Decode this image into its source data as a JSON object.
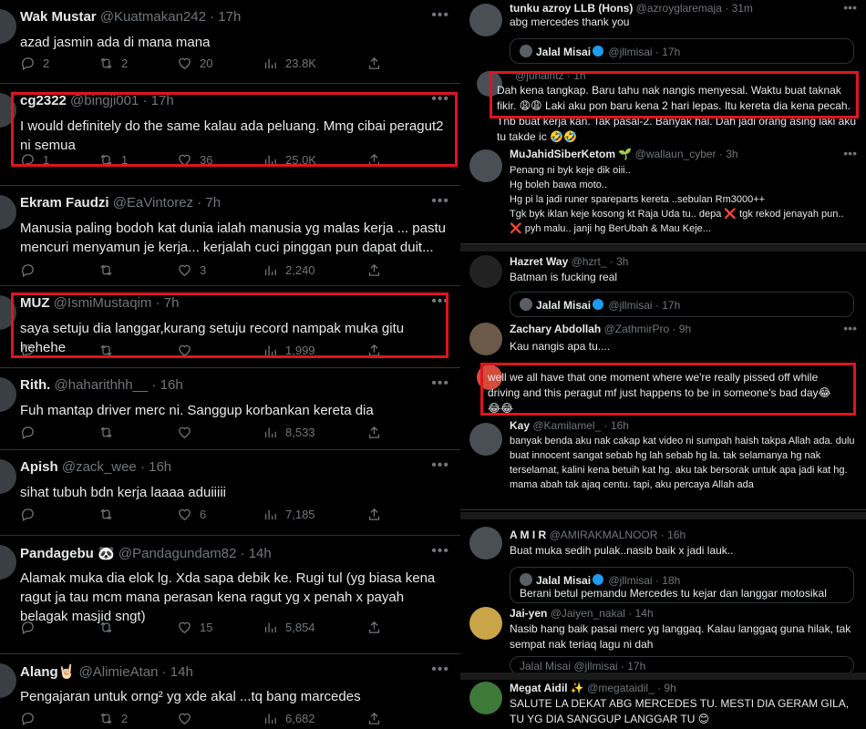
{
  "left": {
    "tweets": [
      {
        "name": "Wak Mustar",
        "handle": "@Kuatmakan242",
        "time": "· 17h",
        "text": "azad jasmin ada di mana mana",
        "replies": "2",
        "retweets": "2",
        "likes": "20",
        "views": "23.8K"
      },
      {
        "name": "cg2322",
        "handle": "@bingji001",
        "time": "· 17h",
        "text": "I would definitely do the same kalau ada peluang. Mmg cibai peragut2 ni semua",
        "replies": "1",
        "retweets": "1",
        "likes": "36",
        "views": "25.0K"
      },
      {
        "name": "Ekram Faudzi",
        "handle": "@EaVintorez",
        "time": "· 7h",
        "text": "Manusia paling bodoh kat dunia ialah manusia yg malas kerja ... pastu mencuri menyamun je kerja... kerjalah cuci pinggan pun dapat duit...",
        "replies": "",
        "retweets": "",
        "likes": "3",
        "views": "2,240"
      },
      {
        "name": "MUZ",
        "handle": "@IsmiMustaqim",
        "time": "· 7h",
        "text": "saya setuju dia langgar,kurang setuju record nampak muka gitu hehehe",
        "replies": "",
        "retweets": "",
        "likes": "",
        "views": "1,999"
      },
      {
        "name": "Rith.",
        "handle": "@haharithhh__",
        "time": "· 16h",
        "text": "Fuh mantap driver merc ni. Sanggup korbankan kereta dia",
        "replies": "",
        "retweets": "",
        "likes": "",
        "views": "8,533"
      },
      {
        "name": "Apish",
        "handle": "@zack_wee",
        "time": "· 16h",
        "text": "sihat tubuh bdn kerja laaaa aduiiiii",
        "replies": "",
        "retweets": "",
        "likes": "6",
        "views": "7,185"
      },
      {
        "name": "Pandagebu 🐼",
        "handle": "@Pandagundam82",
        "time": "· 14h",
        "text": "Alamak muka dia elok lg. Xda sapa debik ke. Rugi tul (yg biasa kena ragut ja tau mcm mana perasan kena ragut yg x penah x payah belagak masjid sngt)",
        "replies": "",
        "retweets": "",
        "likes": "15",
        "views": "5,854"
      },
      {
        "name": "Alang🤘🏻",
        "handle": "@AlimieAtan",
        "time": "· 14h",
        "text": "Pengajaran untuk orng² yg xde akal ...tq bang marcedes",
        "replies": "",
        "retweets": "2",
        "likes": "",
        "views": "6,682"
      }
    ]
  },
  "right": {
    "t1": {
      "name": "tunku azroy LLB (Hons)",
      "handle": "@azroyglaremaja",
      "time": "· 31m",
      "text": "abg mercedes thank you"
    },
    "quote1": {
      "name": "Jalal Misai",
      "handle": "@jllmisai",
      "time": "· 17h"
    },
    "t2": {
      "name": "@junaintz",
      "time": "· 1h",
      "text": "Dah kena tangkap. Baru tahu nak nangis menyesal. Waktu buat taknak fikir. 😩😩 Laki aku pon baru kena 2 hari lepas. Itu kereta dia kena pecah. Tnb buat kerja kan. Tak pasal-2. Banyak hal. Dah jadi orang asing laki aku tu takde ic 🤣🤣"
    },
    "t3": {
      "name": "MuJahidSiberKetom 🌱",
      "handle": "@wallaun_cyber",
      "time": "· 3h",
      "lines": [
        "Penang ni byk keje dik oiii..",
        "Hg boleh bawa moto..",
        "Hg pi la jadi runer spareparts kereta ..sebulan Rm3000++",
        "Tgk byk iklan keje kosong kt Raja Uda tu.. depa ❌ tgk rekod jenayah pun..",
        "❌ pyh malu.. janji hg BerUbah & Mau Keje..."
      ]
    },
    "t4": {
      "name": "Hazret Way",
      "handle": "@hzrt_",
      "time": "· 3h",
      "text": "Batman is fucking real"
    },
    "quote2": {
      "name": "Jalal Misai",
      "handle": "@jllmisai",
      "time": "· 17h"
    },
    "t5": {
      "name": "Zachary Abdollah",
      "handle": "@ZathmirPro",
      "time": "· 9h",
      "text": "Kau nangis apa tu...."
    },
    "t6": {
      "text": "well we all have that one moment where we're really pissed off while driving and this peragut mf just happens to be in someone's bad day😂😂😂"
    },
    "t7": {
      "name": "Kay",
      "handle": "@Kamilamel_",
      "time": "· 16h",
      "text": "banyak benda aku nak cakap kat video ni sumpah haish takpa Allah ada. dulu buat innocent sangat sebab hg lah sebab hg la. tak selamanya hg nak terselamat, kalini kena betuih kat hg. aku tak bersorak untuk apa jadi kat hg. mama abah tak ajaq centu. tapi, aku percaya Allah ada"
    },
    "t8": {
      "name": "A M I R",
      "handle": "@AMIRAKMALNOOR",
      "time": "· 16h",
      "text": "Buat muka sedih pulak..nasib baik x jadi lauk.."
    },
    "quote3": {
      "name": "Jalal Misai",
      "handle": "@jllmisai",
      "time": "· 18h",
      "text": "Berani betul pemandu Mercedes tu kejar dan langgar motosikal"
    },
    "t9": {
      "name": "Jai-yen",
      "handle": "@Jaiyen_nakal",
      "time": "· 14h",
      "text": "Nasib hang baik pasai merc yg langgaq. Kalau langgaq guna hilak, tak sempat nak teriaq lagu ni dah"
    },
    "quote4": {
      "name": "Jalal Misai",
      "handle": "@jllmisai",
      "time": "· 17h"
    },
    "t10": {
      "name": "Megat Aidil ✨",
      "handle": "@megataidil_",
      "time": "· 9h",
      "text": "SALUTE LA DEKAT ABG MERCEDES TU. MESTI DIA GERAM GILA, TU YG DIA SANGGUP LANGGAR TU 😊"
    }
  }
}
